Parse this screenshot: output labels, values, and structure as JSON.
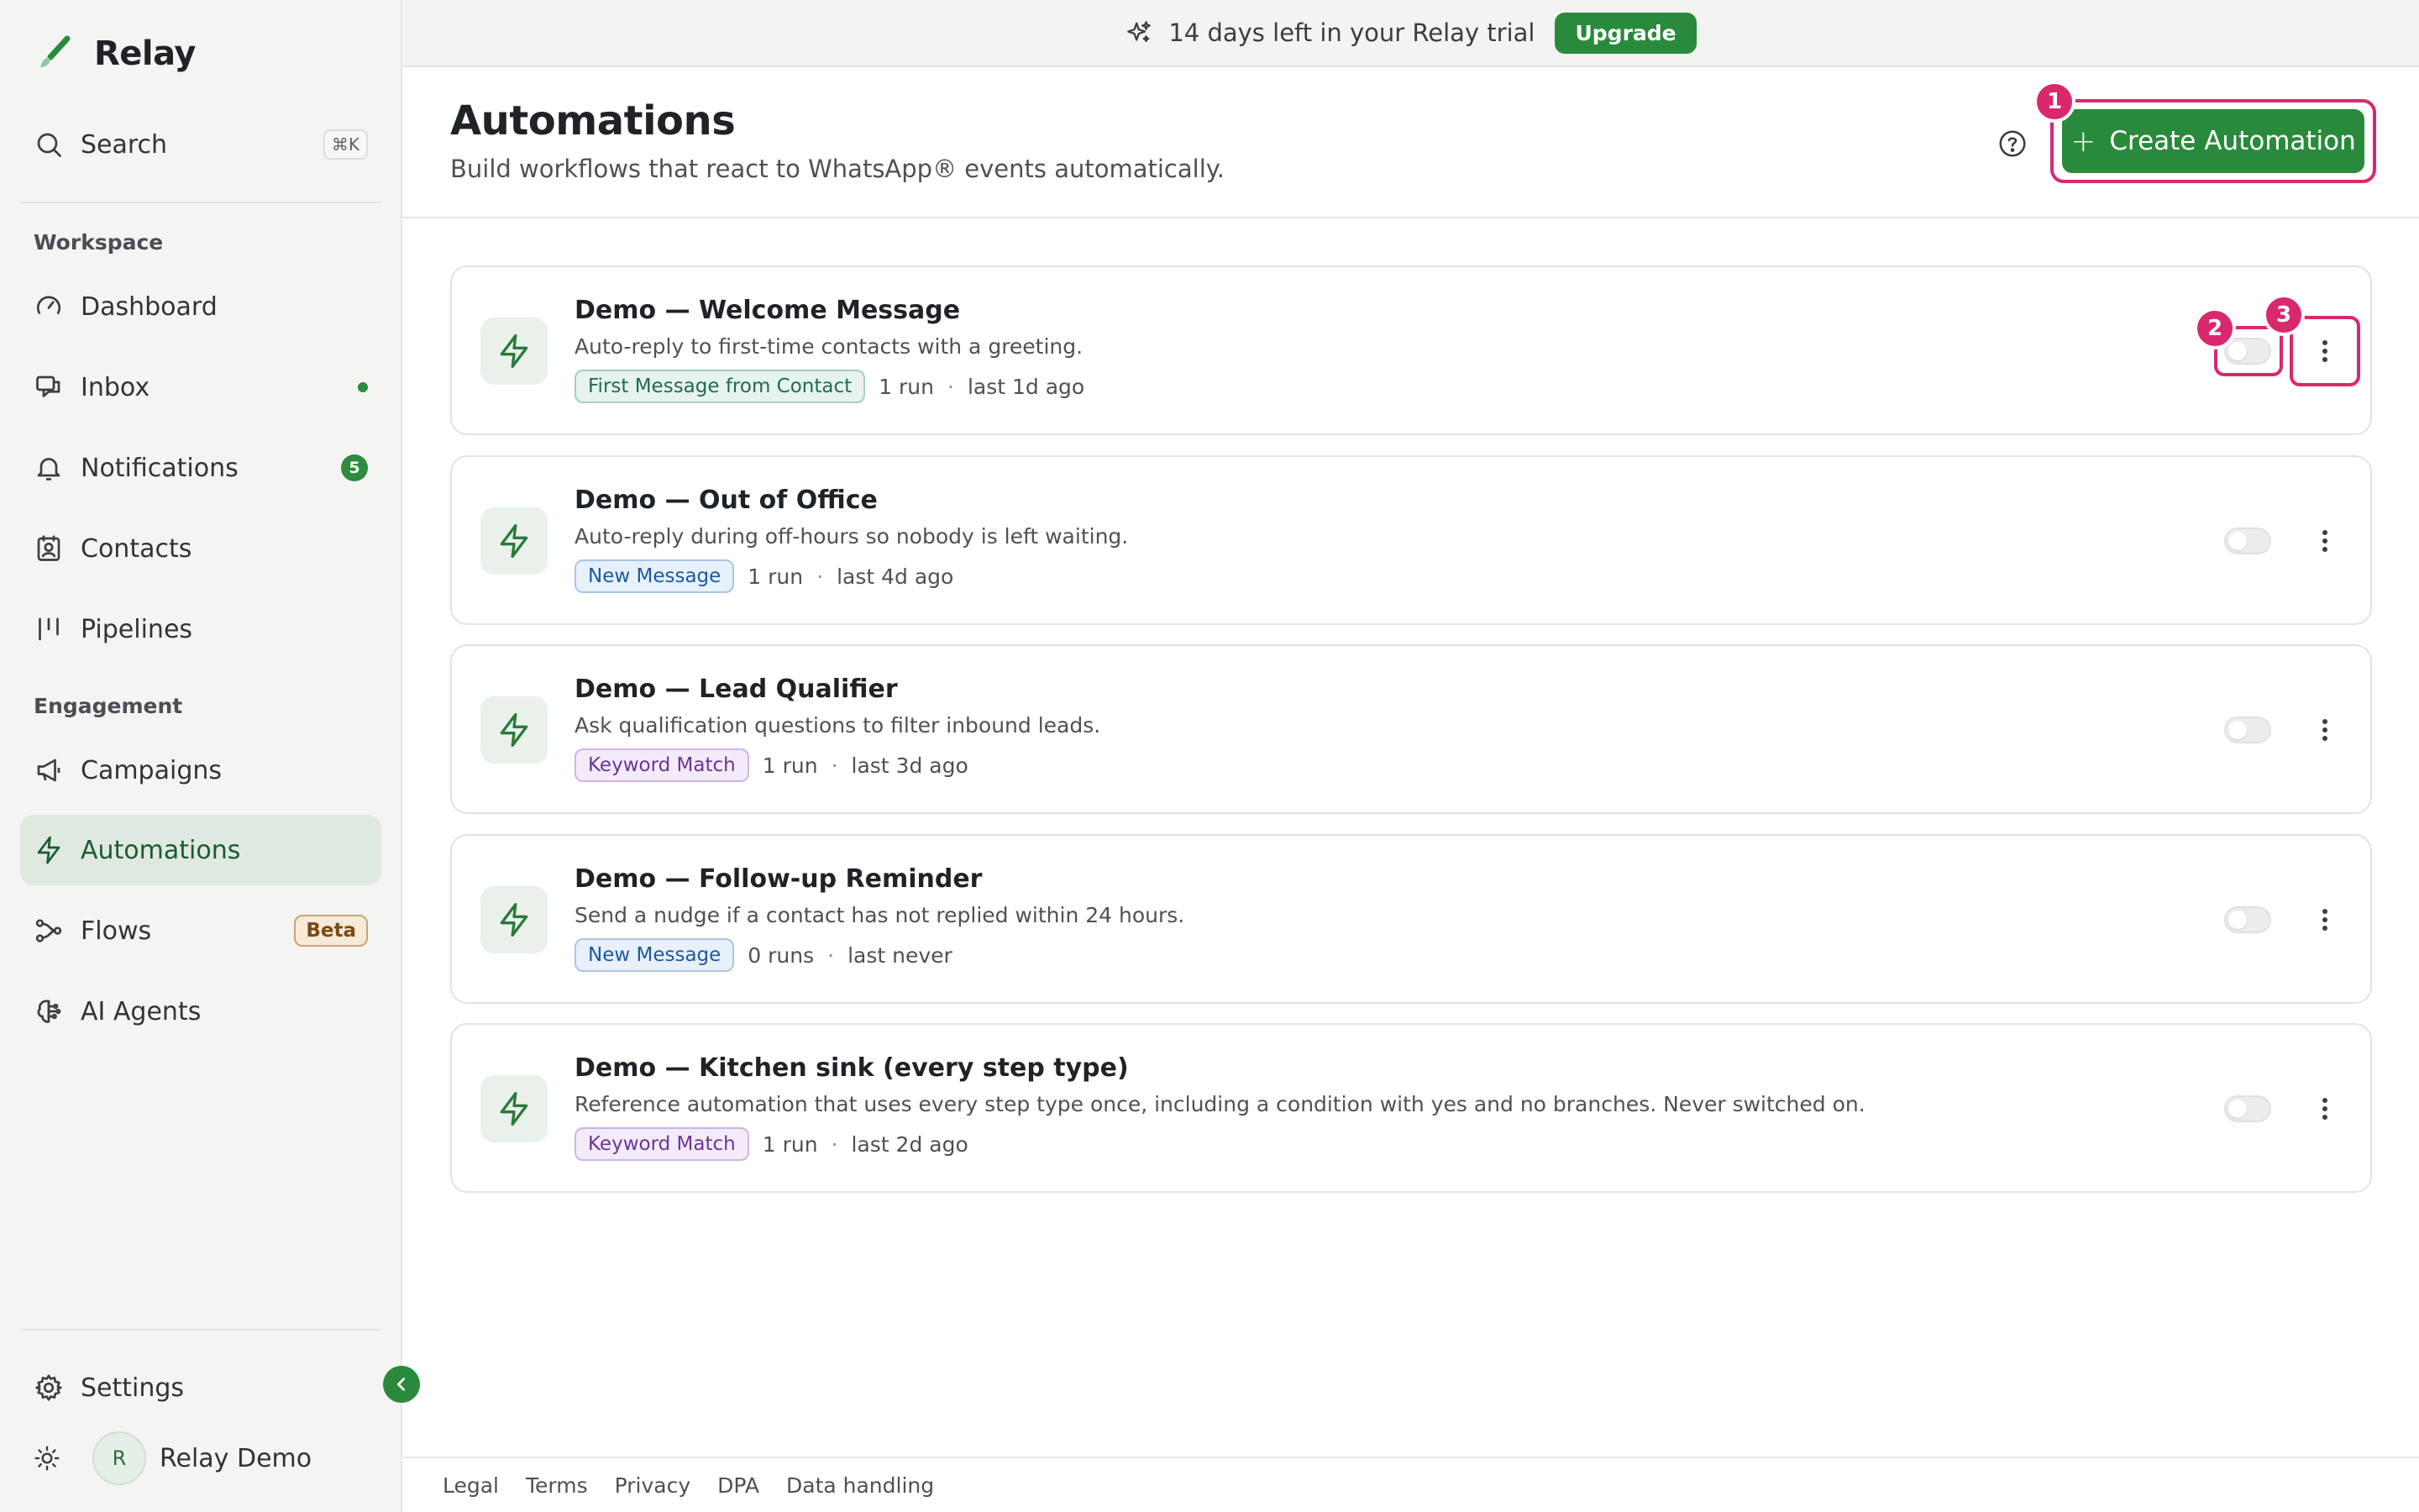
{
  "brand": {
    "name": "Relay"
  },
  "search": {
    "label": "Search",
    "shortcut": "⌘K"
  },
  "sidebar": {
    "sections": {
      "workspace": "Workspace",
      "engagement": "Engagement"
    },
    "items": [
      {
        "id": "dashboard",
        "label": "Dashboard",
        "icon": "gauge-icon"
      },
      {
        "id": "inbox",
        "label": "Inbox",
        "icon": "inbox-icon",
        "has_dot": true
      },
      {
        "id": "notifications",
        "label": "Notifications",
        "icon": "bell-icon",
        "badge": "5"
      },
      {
        "id": "contacts",
        "label": "Contacts",
        "icon": "contact-book-icon"
      },
      {
        "id": "pipelines",
        "label": "Pipelines",
        "icon": "pipeline-icon"
      },
      {
        "id": "campaigns",
        "label": "Campaigns",
        "icon": "megaphone-icon"
      },
      {
        "id": "automations",
        "label": "Automations",
        "icon": "bolt-icon",
        "active": true
      },
      {
        "id": "flows",
        "label": "Flows",
        "icon": "flow-icon",
        "badge": "Beta"
      },
      {
        "id": "ai-agents",
        "label": "AI Agents",
        "icon": "brain-icon"
      }
    ],
    "settings": "Settings",
    "user": {
      "initial": "R",
      "name": "Relay Demo"
    }
  },
  "banner": {
    "text": "14 days left in your Relay trial",
    "upgrade_label": "Upgrade"
  },
  "header": {
    "title": "Automations",
    "subtitle": "Build workflows that react to WhatsApp® events automatically.",
    "create_label": "Create Automation"
  },
  "markers": [
    "1",
    "2",
    "3"
  ],
  "automations": [
    {
      "title": "Demo — Welcome Message",
      "description": "Auto-reply to first-time contacts with a greeting.",
      "trigger": "First Message from Contact",
      "runs": "1 run",
      "last": "last 1d ago",
      "enabled": false
    },
    {
      "title": "Demo — Out of Office",
      "description": "Auto-reply during off-hours so nobody is left waiting.",
      "trigger": "New Message",
      "runs": "1 run",
      "last": "last 4d ago",
      "enabled": false
    },
    {
      "title": "Demo — Lead Qualifier",
      "description": "Ask qualification questions to filter inbound leads.",
      "trigger": "Keyword Match",
      "runs": "1 run",
      "last": "last 3d ago",
      "enabled": false
    },
    {
      "title": "Demo — Follow-up Reminder",
      "description": "Send a nudge if a contact has not replied within 24 hours.",
      "trigger": "New Message",
      "runs": "0 runs",
      "last": "last never",
      "enabled": false
    },
    {
      "title": "Demo — Kitchen sink (every step type)",
      "description": "Reference automation that uses every step type once, including a condition with yes and no branches. Never switched on.",
      "trigger": "Keyword Match",
      "runs": "1 run",
      "last": "last 2d ago",
      "enabled": false
    }
  ],
  "footer": {
    "links": [
      "Legal",
      "Terms",
      "Privacy",
      "DPA",
      "Data handling"
    ]
  },
  "colors": {
    "accent": "#2a8a3c",
    "highlight": "#d9286d",
    "sidebar_bg": "#f4f4f3",
    "active_bg": "#dfe9e0"
  }
}
